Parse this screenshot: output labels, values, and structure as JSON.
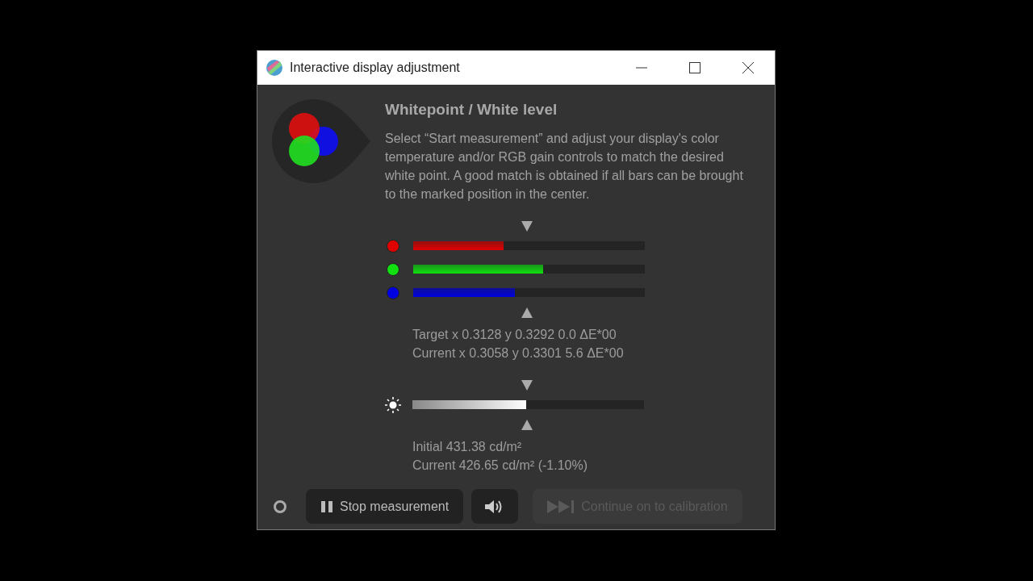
{
  "window": {
    "title": "Interactive display adjustment"
  },
  "heading": "Whitepoint / White level",
  "description": "Select “Start measurement” and adjust your display's color temperature and/or RGB gain controls to match the desired white point. A good match is obtained if all bars can be brought to the marked position in the center.",
  "channels": [
    {
      "color": "#e00000",
      "level": 0.39
    },
    {
      "color": "#10e010",
      "level": 0.56
    },
    {
      "color": "#0000e0",
      "level": 0.44
    }
  ],
  "chromaticity": [
    "Target x 0.3128 y 0.3292 0.0 ΔE*00",
    "Current x 0.3058 y 0.3301 5.6 ΔE*00"
  ],
  "brightness": {
    "level": 0.49
  },
  "luminance": [
    "Initial 431.38 cd/m²",
    "Current 426.65 cd/m² (-1.10%)"
  ],
  "footer": {
    "measuring": false,
    "stop_button": "Stop measurement",
    "continue_button": {
      "label": "Continue on to calibration",
      "disabled": true
    }
  }
}
